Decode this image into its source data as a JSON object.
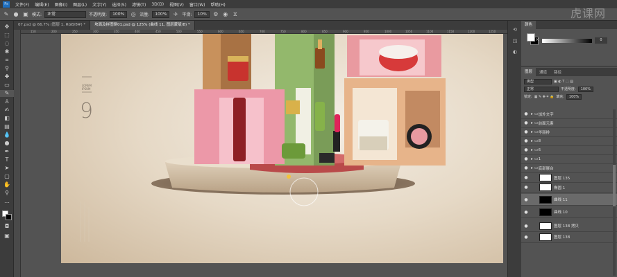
{
  "menu": [
    "文件(F)",
    "编辑(E)",
    "图像(I)",
    "图层(L)",
    "文字(Y)",
    "选择(S)",
    "滤镜(T)",
    "3D(D)",
    "视图(V)",
    "窗口(W)",
    "帮助(H)"
  ],
  "options": {
    "mode_label": "模式:",
    "mode_value": "正常",
    "opacity_label": "不透明度:",
    "opacity_value": "100%",
    "flow_label": "流量:",
    "flow_value": "100%",
    "smooth_label": "平滑:",
    "smooth_value": "10%"
  },
  "watermark": "虎课网",
  "tabs": [
    "07.psd @ 66.7% (图层 1, RGB/8#) *",
    "块面及拼图倒01.psd @ 125% (曲线 11, 图层蒙版/8) *"
  ],
  "ruler_ticks": [
    "150",
    "200",
    "250",
    "300",
    "350",
    "400",
    "450",
    "500",
    "550",
    "600",
    "650",
    "700",
    "750",
    "800",
    "850",
    "900",
    "950",
    "1000",
    "1050",
    "1100",
    "1150",
    "1200",
    "1250"
  ],
  "artwork": {
    "number": "9",
    "small_text_1": "LOREM",
    "small_text_2": "IPSUM"
  },
  "color_panel": {
    "tab": "颜色",
    "k_label": "K",
    "k_value": "0"
  },
  "layers_panel": {
    "tabs": [
      "图层",
      "通道",
      "路径"
    ],
    "filter_label": "类型",
    "blend_mode": "正常",
    "opacity_label": "不透明度:",
    "opacity_value": "100%",
    "lock_label": "锁定:",
    "fill_label": "填充:",
    "fill_value": "100%",
    "layers": [
      {
        "name": "加外文字",
        "type": "group"
      },
      {
        "name": "前面元素",
        "type": "group"
      },
      {
        "name": "华丽排",
        "type": "group"
      },
      {
        "name": "8",
        "type": "group"
      },
      {
        "name": "6",
        "type": "group"
      },
      {
        "name": "1",
        "type": "group"
      },
      {
        "name": "底部展台",
        "type": "group"
      },
      {
        "name": "图层 135",
        "type": "layer"
      },
      {
        "name": "椭圆 1",
        "type": "layer"
      },
      {
        "name": "曲线 11",
        "type": "adjust"
      },
      {
        "name": "曲线 10",
        "type": "adjust"
      },
      {
        "name": "图层 138 拷贝",
        "type": "layer"
      },
      {
        "name": "图层 138",
        "type": "layer"
      }
    ]
  }
}
